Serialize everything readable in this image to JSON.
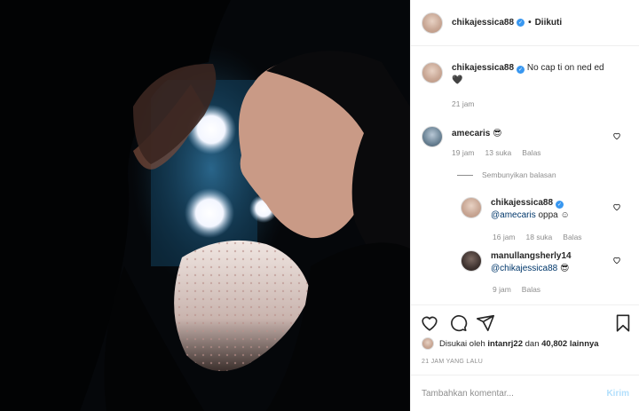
{
  "photo": {
    "alt_icon": "couple-silhouette-photo"
  },
  "header": {
    "username": "chikajessica88",
    "verified_icon": "verified-badge-icon",
    "separator": "•",
    "follow_status": "Diikuti"
  },
  "caption": {
    "username": "chikajessica88",
    "text": "No cap ti on ned ed",
    "emoji": "🖤",
    "time": "21 jam"
  },
  "comments": [
    {
      "username": "amecaris",
      "text": "😎",
      "time": "19 jam",
      "likes": "13 suka",
      "reply": "Balas"
    }
  ],
  "hide_replies": "Sembunyikan balasan",
  "replies": [
    {
      "username": "chikajessica88",
      "mention": "@amecaris",
      "text": "oppa ☺",
      "time": "16 jam",
      "likes": "18 suka",
      "reply": "Balas"
    },
    {
      "username": "manullangsherly14",
      "mention": "@chikajessica88",
      "text": "😎",
      "time": "9 jam",
      "reply": "Balas"
    }
  ],
  "likes": {
    "prefix": "Disukai oleh",
    "user": "intanrj22",
    "mid": "dan",
    "count": "40,802 lainnya"
  },
  "timestamp": "21 JAM YANG LALU",
  "add_comment": {
    "placeholder": "Tambahkan komentar...",
    "post_label": "Kirim"
  },
  "colors": {
    "accent": "#3897f0",
    "muted": "#8e8e8e",
    "post_disabled": "#b2dffc"
  }
}
